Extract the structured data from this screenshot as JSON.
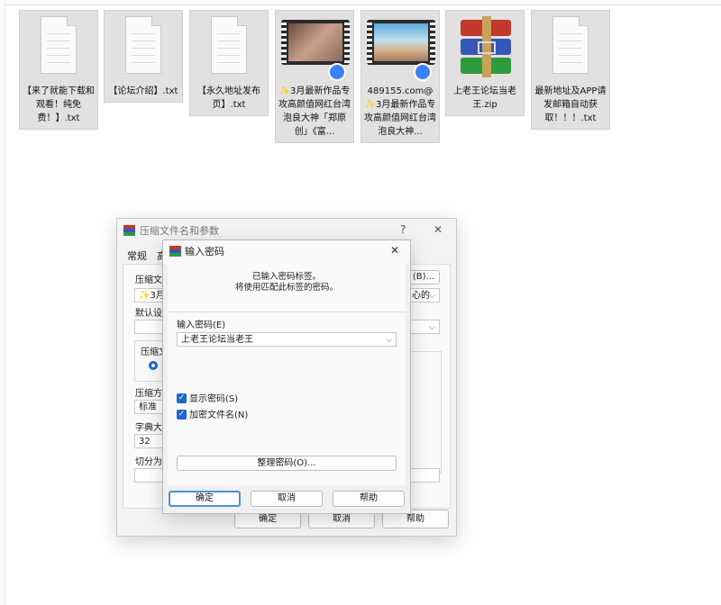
{
  "files": [
    {
      "name": "【来了就能下载和观看！纯免费！】.txt",
      "kind": "txt"
    },
    {
      "name": "【论坛介绍】.txt",
      "kind": "txt"
    },
    {
      "name": "【永久地址发布页】.txt",
      "kind": "txt"
    },
    {
      "name": "✨3月最新作品专攻高颜值网红台湾泡良大神「郑原创」《富...",
      "kind": "video"
    },
    {
      "name": "489155.com@✨3月最新作品专攻高颜值网红台湾泡良大神...",
      "kind": "video"
    },
    {
      "name": "上老王论坛当老王.zip",
      "kind": "zip"
    },
    {
      "name": "最新地址及APP请发邮箱自动获取！！！.txt",
      "kind": "txt"
    }
  ],
  "back_dialog": {
    "title": "压缩文件名和参数",
    "help_icon": "?",
    "close_icon": "✕",
    "tab_general": "常规",
    "tab_advanced": "高",
    "archive_name_label": "压缩文",
    "archive_name_value": "✨3月…",
    "browse_button": "(B)...",
    "update_mode_value": "心的",
    "default_profile_label": "默认设",
    "format_label": "压缩文",
    "method_label": "压缩方",
    "method_value": "标准",
    "dict_label": "字典大",
    "dict_value": "32",
    "split_label": "切分为",
    "ok": "确定",
    "cancel": "取消",
    "help": "帮助"
  },
  "password_dialog": {
    "title": "输入密码",
    "close_icon": "✕",
    "info_line1": "已输入密码标签。",
    "info_line2": "将使用匹配此标签的密码。",
    "password_label": "输入密码(E)",
    "password_value": "上老王论坛当老王",
    "show_password": "显示密码(S)",
    "encrypt_names": "加密文件名(N)",
    "organize_button": "整理密码(O)...",
    "ok": "确定",
    "cancel": "取消",
    "help": "帮助"
  },
  "colors": {
    "accent": "#1e66c9",
    "file_bg": "#e1e1e1"
  }
}
